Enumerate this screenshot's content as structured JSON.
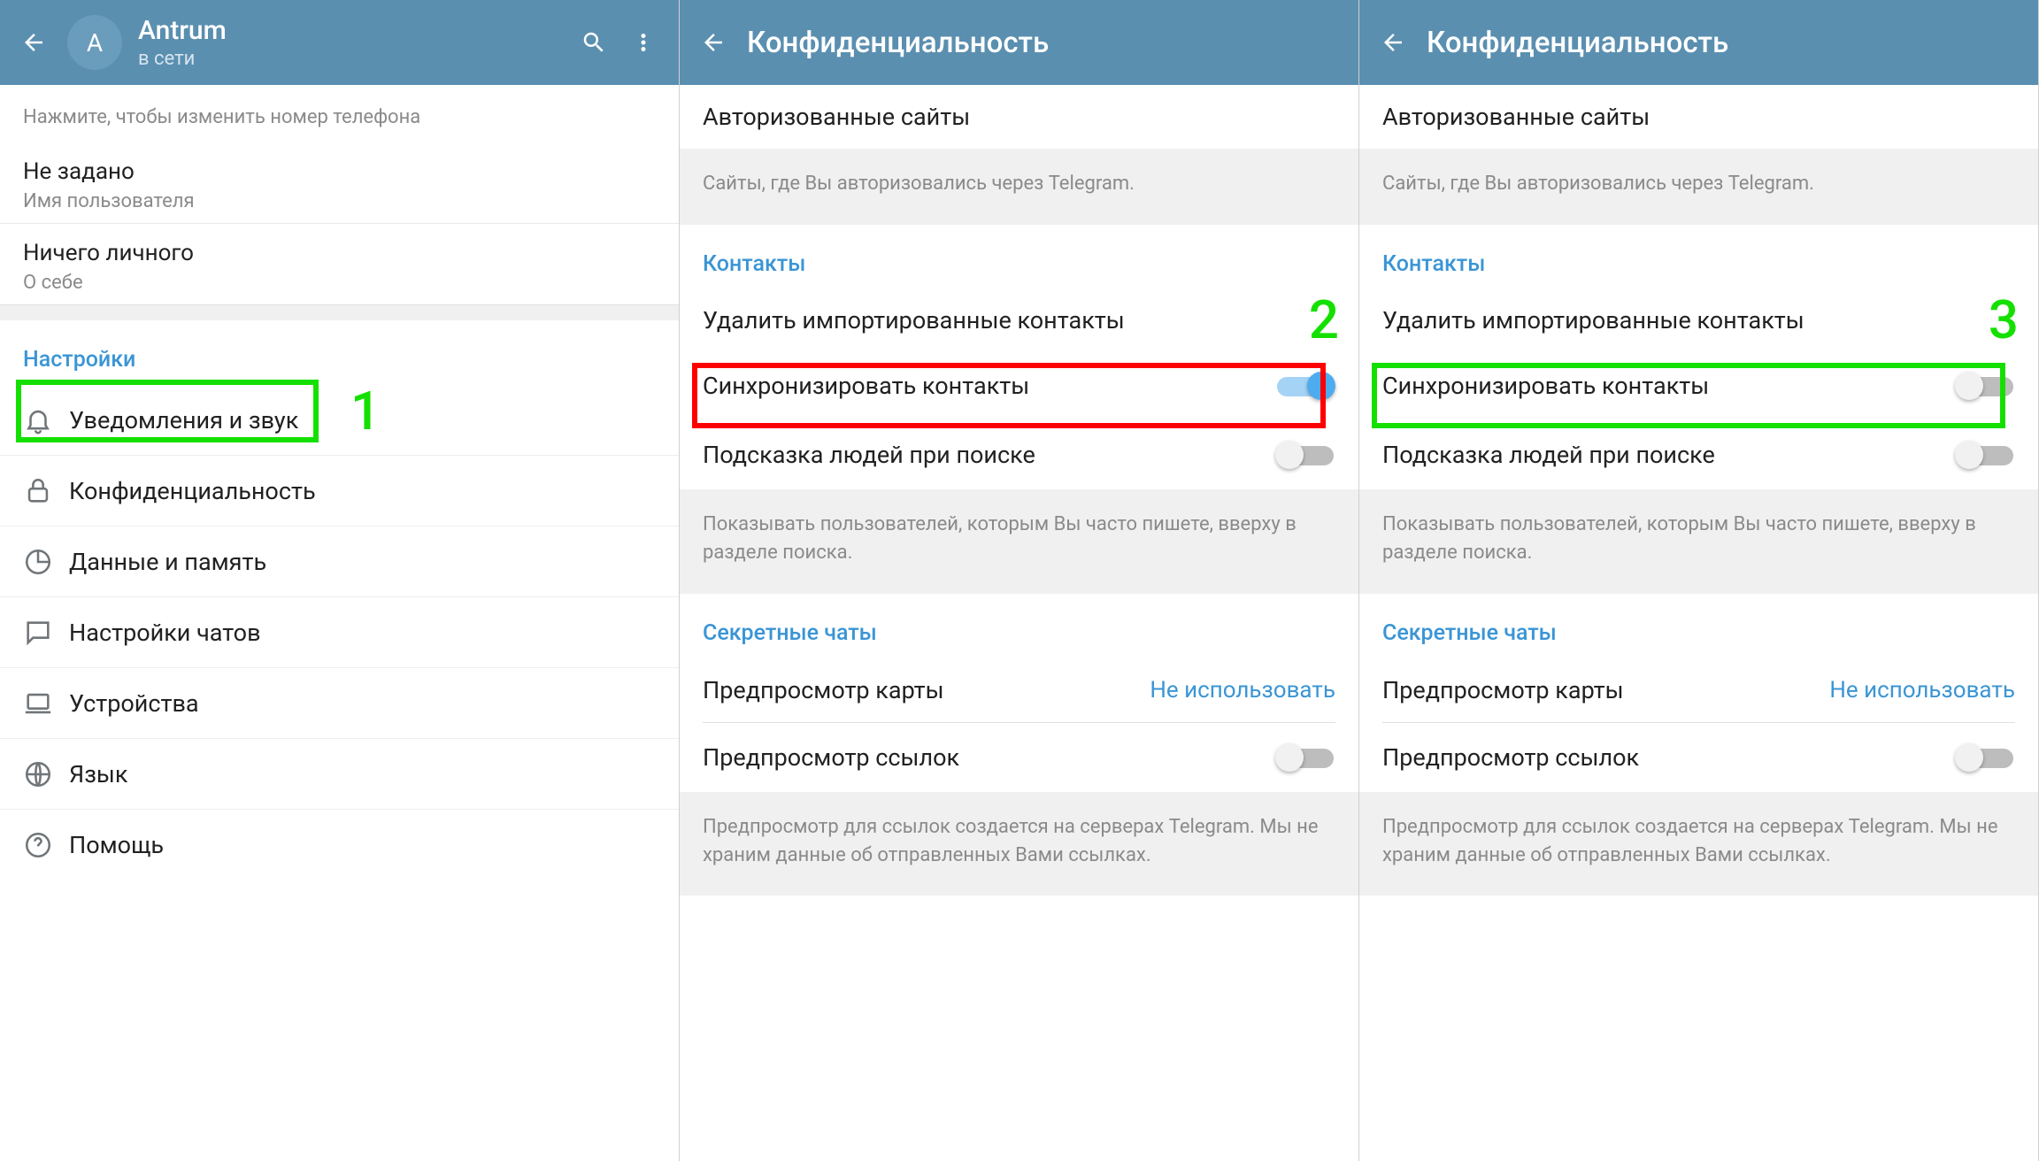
{
  "pane1": {
    "profile_name": "Antrum",
    "profile_status": "в сети",
    "avatar_letter": "А",
    "hint_phone": "Нажмите, чтобы изменить номер телефона",
    "username_value": "Не задано",
    "username_label": "Имя пользователя",
    "bio_value": "Ничего личного",
    "bio_label": "О себе",
    "settings_header": "Настройки",
    "menu": {
      "notifications": "Уведомления и звук",
      "privacy": "Конфиденциальность",
      "data": "Данные и память",
      "chats": "Настройки чатов",
      "devices": "Устройства",
      "language": "Язык",
      "help": "Помощь"
    },
    "highlight_number": "1"
  },
  "pane2": {
    "title": "Конфиденциальность",
    "authorized_sites": "Авторизованные сайты",
    "authorized_hint": "Сайты, где Вы авторизовались через Telegram.",
    "contacts_header": "Контакты",
    "delete_imported": "Удалить импортированные контакты",
    "sync_contacts": "Синхронизировать контакты",
    "sync_state": "on",
    "suggest_people": "Подсказка людей при поиске",
    "suggest_state": "off",
    "suggest_hint": "Показывать пользователей, которым Вы часто пишете, вверху в разделе поиска.",
    "secret_chats_header": "Секретные чаты",
    "map_preview": "Предпросмотр карты",
    "map_preview_value": "Не использовать",
    "link_preview": "Предпросмотр ссылок",
    "link_preview_state": "off",
    "link_hint": "Предпросмотр для ссылок создается на серверах Telegram. Мы не храним данные об отправленных Вами ссылках.",
    "highlight_number": "2"
  },
  "pane3": {
    "title": "Конфиденциальность",
    "authorized_sites": "Авторизованные сайты",
    "authorized_hint": "Сайты, где Вы авторизовались через Telegram.",
    "contacts_header": "Контакты",
    "delete_imported": "Удалить импортированные контакты",
    "sync_contacts": "Синхронизировать контакты",
    "sync_state": "off",
    "suggest_people": "Подсказка людей при поиске",
    "suggest_state": "off",
    "suggest_hint": "Показывать пользователей, которым Вы часто пишете, вверху в разделе поиска.",
    "secret_chats_header": "Секретные чаты",
    "map_preview": "Предпросмотр карты",
    "map_preview_value": "Не использовать",
    "link_preview": "Предпросмотр ссылок",
    "link_preview_state": "off",
    "link_hint": "Предпросмотр для ссылок создается на серверах Telegram. Мы не храним данные об отправленных Вами ссылках.",
    "highlight_number": "3"
  }
}
